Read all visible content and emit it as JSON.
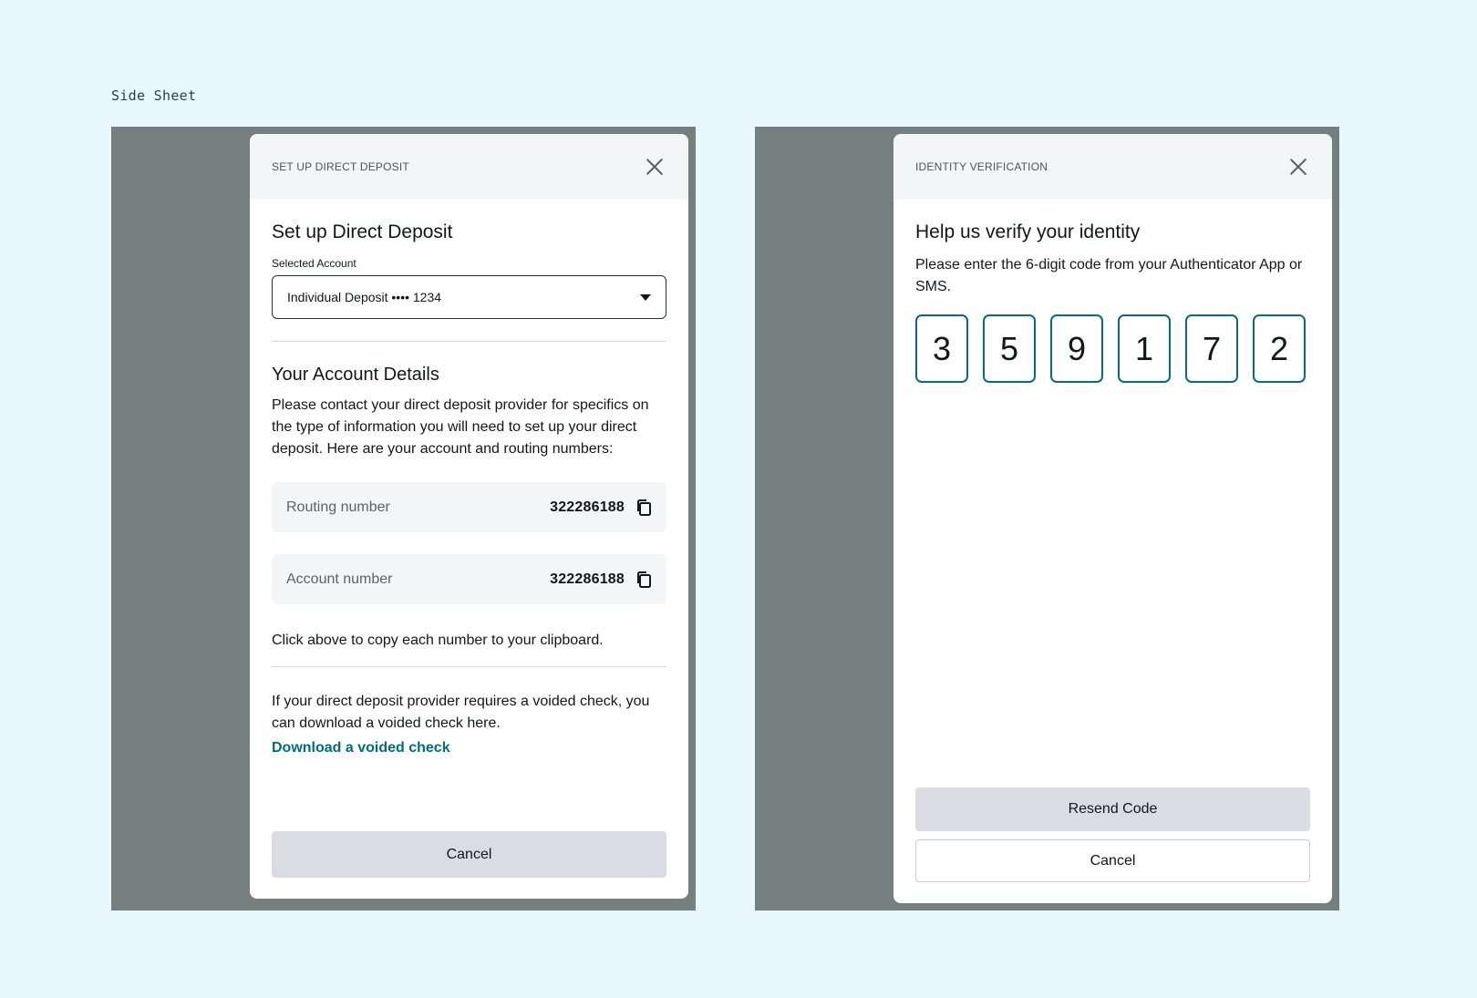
{
  "page_label": "Side Sheet",
  "direct_deposit": {
    "header_title": "SET UP DIRECT DEPOSIT",
    "title": "Set up Direct Deposit",
    "selected_account_label": "Selected Account",
    "selected_account_value": "Individual Deposit •••• 1234",
    "details_title": "Your Account Details",
    "details_text": "Please contact your direct deposit provider for specifics on the type of information you will need to set up your direct deposit. Here are your account and routing numbers:",
    "routing_label": "Routing number",
    "routing_value": "322286188",
    "account_label": "Account number",
    "account_value": "322286188",
    "copy_note": "Click above to copy each number to your clipboard.",
    "voided_text": "If your direct deposit provider requires a voided check, you can download a voided check here.",
    "download_link": "Download a voided check",
    "cancel_label": "Cancel"
  },
  "identity": {
    "header_title": "IDENTITY VERIFICATION",
    "title": "Help us verify your identity",
    "instructions": "Please enter the 6-digit code from your Authenticator App or SMS.",
    "code": [
      "3",
      "5",
      "9",
      "1",
      "7",
      "2"
    ],
    "resend_label": "Resend Code",
    "cancel_label": "Cancel"
  },
  "colors": {
    "page_bg": "#e8f8fd",
    "overlay": "#767f80",
    "accent": "#006b7a",
    "otp_border": "#0b6a7a"
  }
}
